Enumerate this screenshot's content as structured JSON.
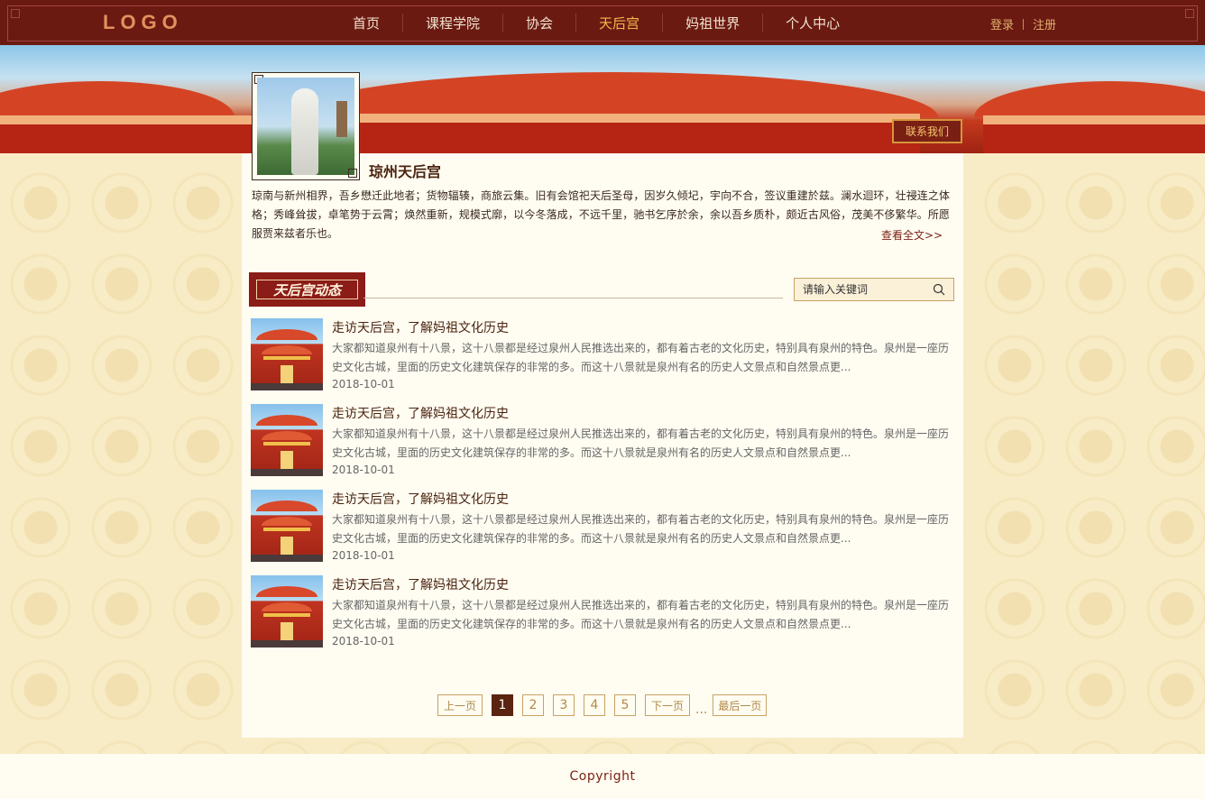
{
  "header": {
    "logo": "LOGO",
    "nav": [
      {
        "label": "首页"
      },
      {
        "label": "课程学院"
      },
      {
        "label": "协会"
      },
      {
        "label": "天后宫",
        "active": true
      },
      {
        "label": "妈祖世界"
      },
      {
        "label": "个人中心"
      }
    ],
    "login": "登录",
    "register": "注册"
  },
  "banner": {
    "contact_button": "联系我们"
  },
  "profile": {
    "name": "琼州天后宫",
    "intro": "琼南与新州相界，吾乡懋迁此地者；货物辐辏，商旅云集。旧有会馆祀天后圣母，因岁久倾圮，宇向不合，签议重建於兹。澜水迴环，壮祲连之体格；秀峰耸拔，卓笔势于云霄；焕然重新，规模式廓，以今冬落成，不远千里，驰书乞序於余，余以吾乡质朴，颇近古风俗，茂美不侈繁华。所愿服贾来兹者乐也。",
    "read_more": "查看全文>>"
  },
  "section": {
    "title": "天后宫动态",
    "search_placeholder": "请输入关键词"
  },
  "news": [
    {
      "title": "走访天后宫，了解妈祖文化历史",
      "desc": "大家都知道泉州有十八景，这十八景都是经过泉州人民推选出来的，都有着古老的文化历史，特别具有泉州的特色。泉州是一座历史文化古城，里面的历史文化建筑保存的非常的多。而这十八景就是泉州有名的历史人文景点和自然景点更...",
      "date": "2018-10-01"
    },
    {
      "title": "走访天后宫，了解妈祖文化历史",
      "desc": "大家都知道泉州有十八景，这十八景都是经过泉州人民推选出来的，都有着古老的文化历史，特别具有泉州的特色。泉州是一座历史文化古城，里面的历史文化建筑保存的非常的多。而这十八景就是泉州有名的历史人文景点和自然景点更...",
      "date": "2018-10-01"
    },
    {
      "title": "走访天后宫，了解妈祖文化历史",
      "desc": "大家都知道泉州有十八景，这十八景都是经过泉州人民推选出来的，都有着古老的文化历史，特别具有泉州的特色。泉州是一座历史文化古城，里面的历史文化建筑保存的非常的多。而这十八景就是泉州有名的历史人文景点和自然景点更...",
      "date": "2018-10-01"
    },
    {
      "title": "走访天后宫，了解妈祖文化历史",
      "desc": "大家都知道泉州有十八景，这十八景都是经过泉州人民推选出来的，都有着古老的文化历史，特别具有泉州的特色。泉州是一座历史文化古城，里面的历史文化建筑保存的非常的多。而这十八景就是泉州有名的历史人文景点和自然景点更...",
      "date": "2018-10-01"
    }
  ],
  "pagination": {
    "prev": "上一页",
    "pages": [
      "1",
      "2",
      "3",
      "4",
      "5"
    ],
    "current": "1",
    "next": "下一页",
    "ellipsis": "...",
    "last": "最后一页"
  },
  "footer": {
    "copyright": "Copyright"
  }
}
